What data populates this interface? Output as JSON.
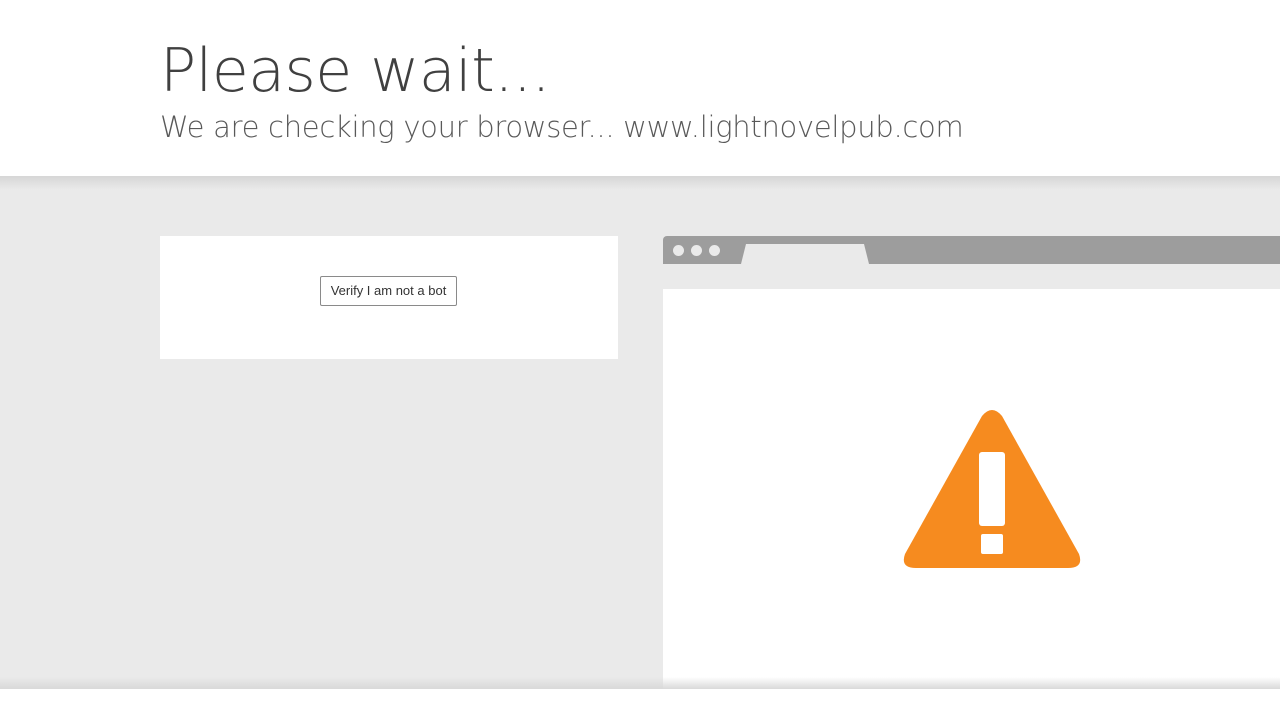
{
  "header": {
    "title": "Please wait...",
    "subtitle": "We are checking your browser... www.lightnovelpub.com"
  },
  "verify": {
    "button_label": "Verify I am not a bot"
  },
  "browser_illustration": {
    "icon": "warning-icon",
    "icon_color": "#f68b1f",
    "bar_color": "#9d9d9d"
  },
  "colors": {
    "band": "#eaeaea",
    "title_text": "#404040",
    "subtitle_text": "#595959"
  }
}
